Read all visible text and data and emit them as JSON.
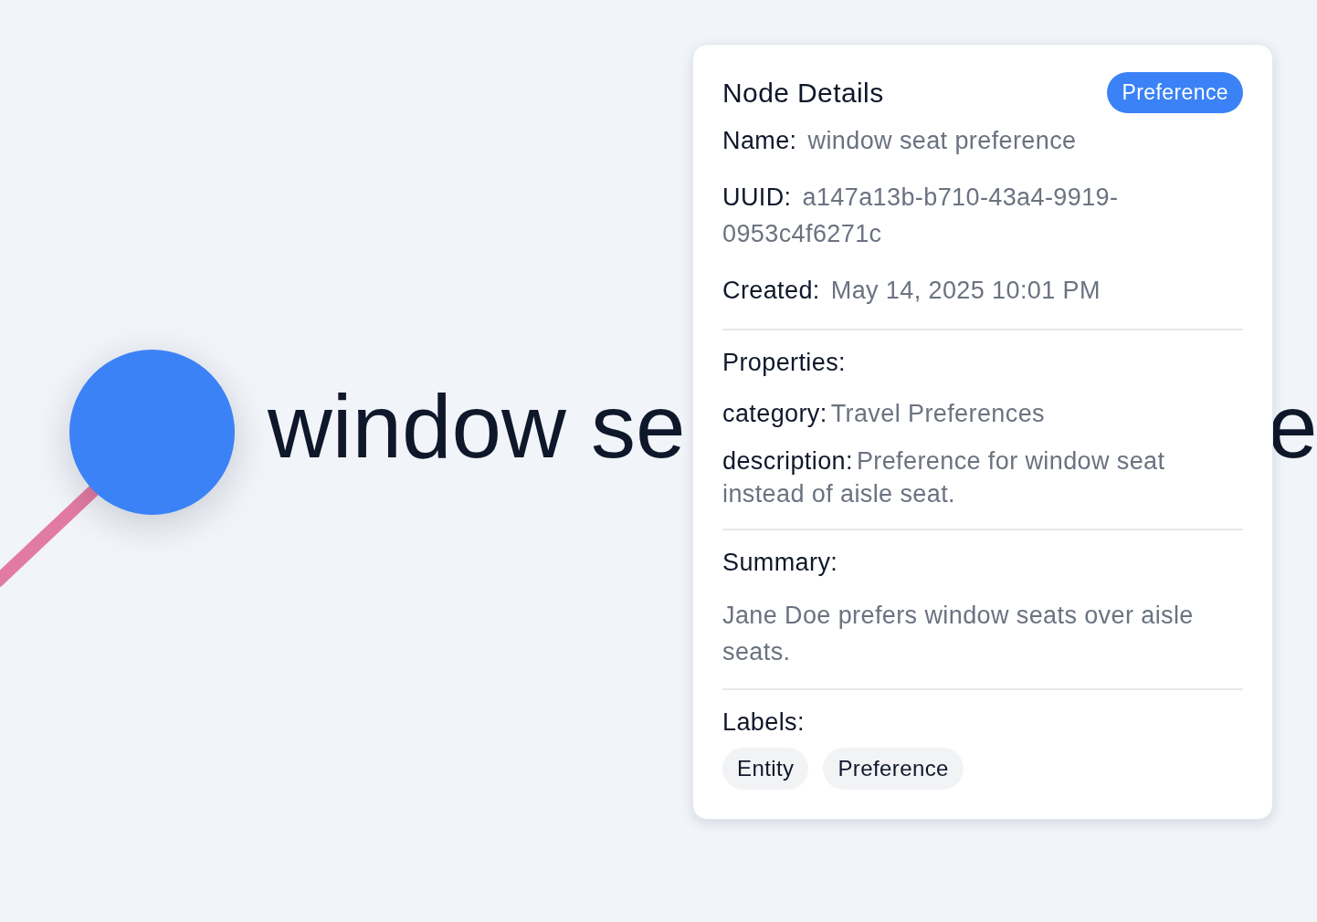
{
  "graph": {
    "nodes": [
      {
        "label": "window se",
        "label_end": "e"
      }
    ]
  },
  "details": {
    "title": "Node Details",
    "badge": "Preference",
    "fields": [
      {
        "label": "Name:",
        "value": "window seat preference"
      },
      {
        "label": "UUID:",
        "value": "a147a13b-b710-43a4-9919-0953c4f6271c"
      },
      {
        "label": "Created:",
        "value": "May 14, 2025 10:01 PM"
      }
    ],
    "properties_heading": "Properties:",
    "properties": [
      {
        "key": "category:",
        "value": "Travel Preferences"
      },
      {
        "key": "description:",
        "value": "Preference for window seat instead of aisle seat."
      }
    ],
    "summary_heading": "Summary:",
    "summary": "Jane Doe prefers window seats over aisle seats.",
    "labels_heading": "Labels:",
    "labels": [
      "Entity",
      "Preference"
    ]
  }
}
